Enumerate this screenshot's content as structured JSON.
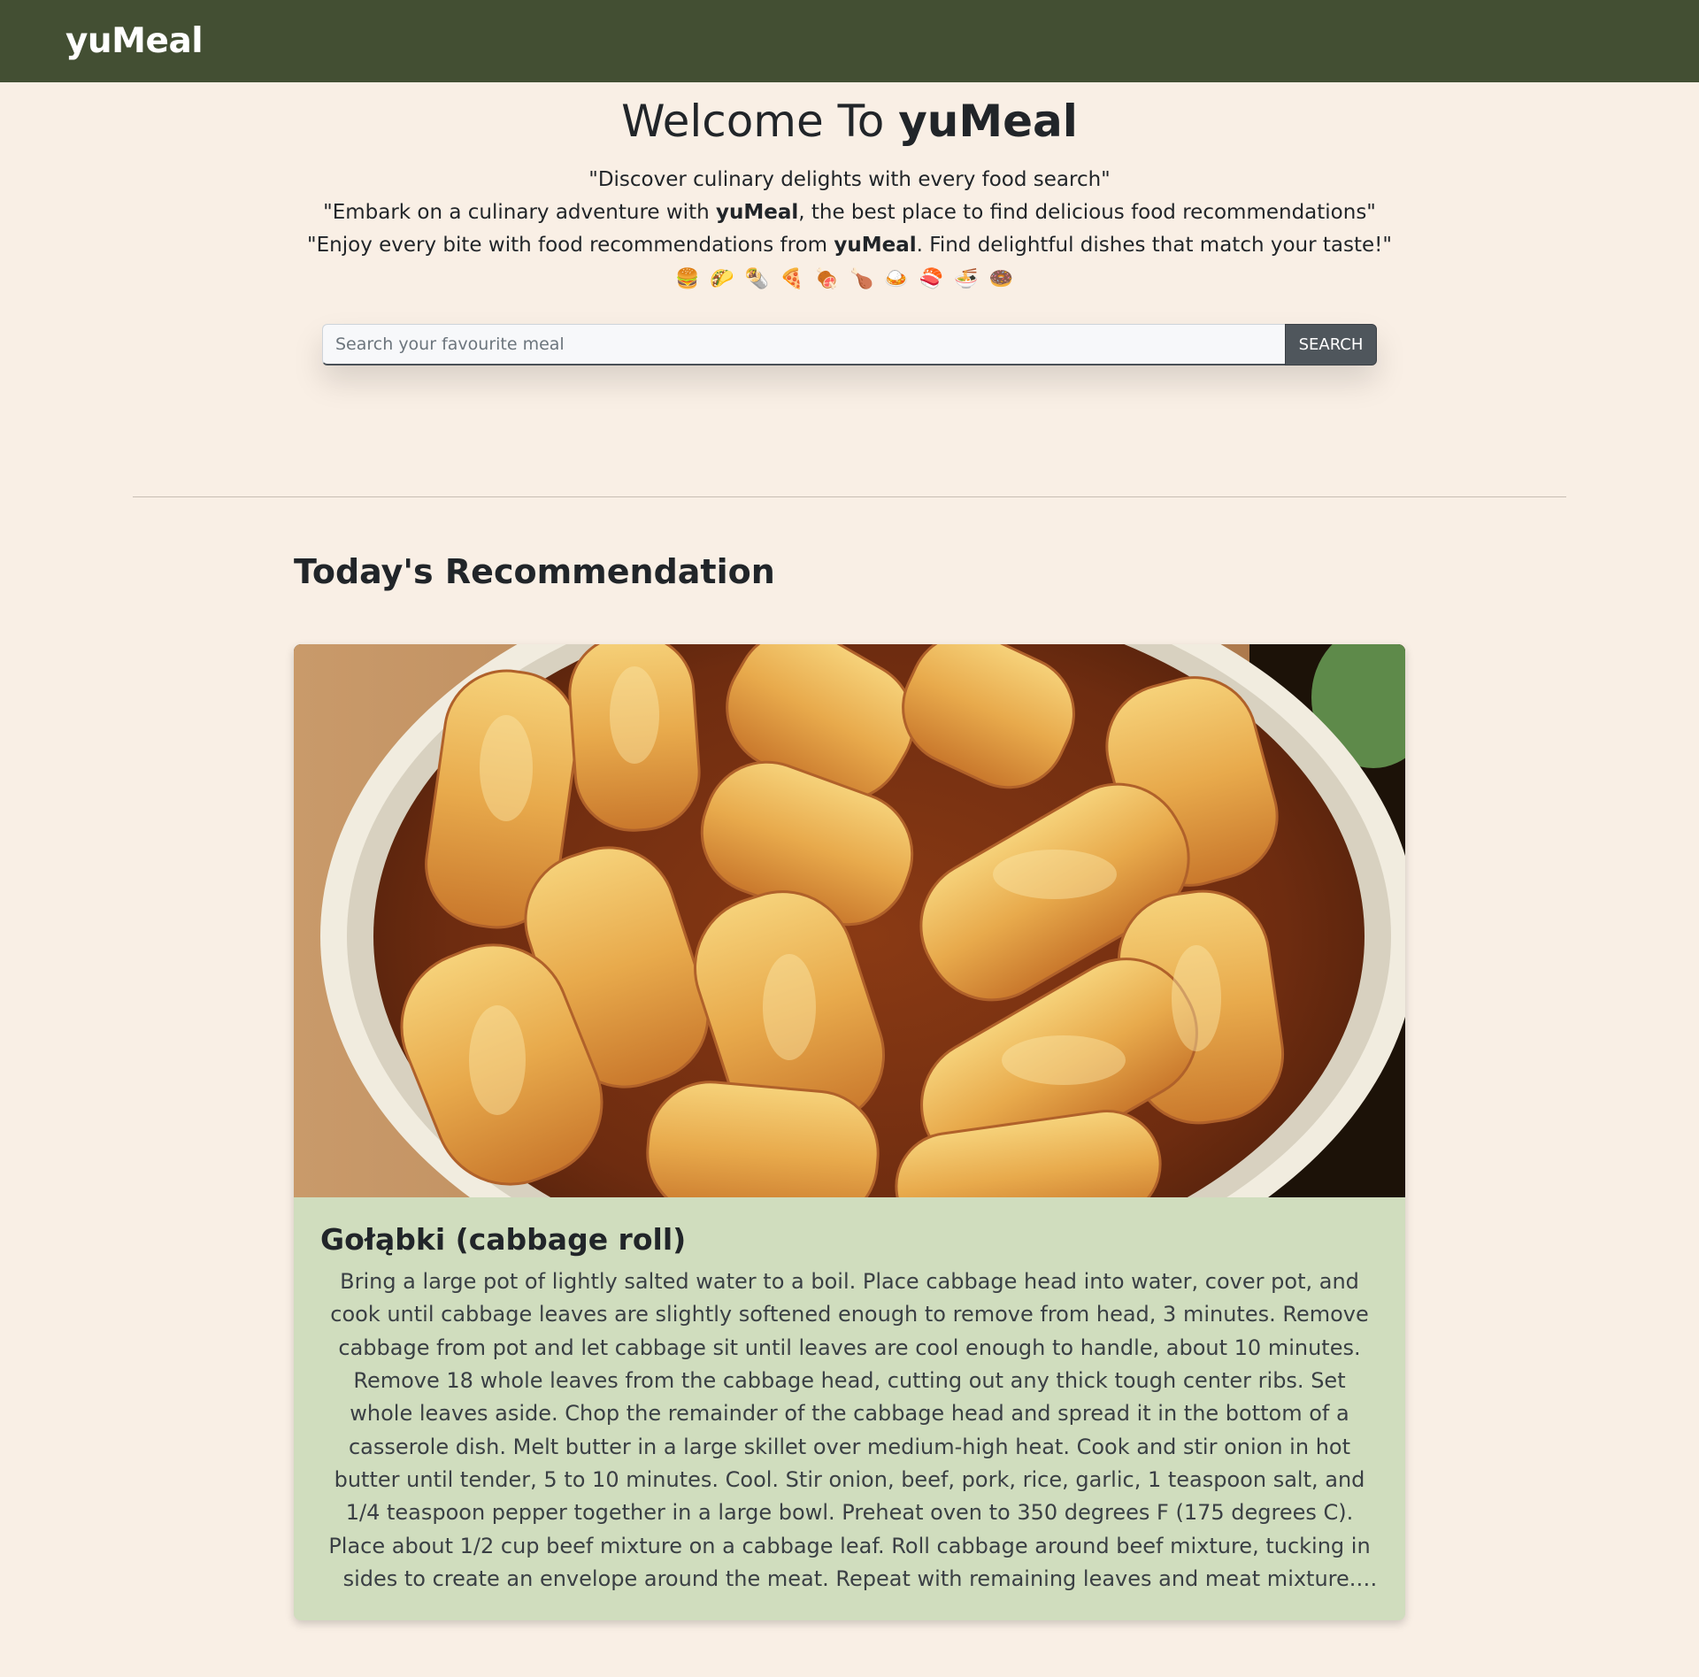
{
  "navbar": {
    "brand": "yuMeal"
  },
  "hero": {
    "title_prefix": "Welcome To ",
    "title_brand": "yuMeal",
    "tagline1": "\"Discover culinary delights with every food search\"",
    "tagline2_pre": "\"Embark on a culinary adventure with ",
    "tagline2_brand": "yuMeal",
    "tagline2_post": ", the best place to find delicious food recommendations\"",
    "tagline3_pre": "\"Enjoy every bite with food recommendations from ",
    "tagline3_brand": "yuMeal",
    "tagline3_post": ". Find delightful dishes that match your taste!\"",
    "emojis": "🍔🌮🌯🍕🍖🍗🍛🍣🍜🍩"
  },
  "search": {
    "placeholder": "Search your favourite meal",
    "value": "",
    "button_label": "SEARCH"
  },
  "recommendation": {
    "heading": "Today's Recommendation",
    "meal_name": "Gołąbki (cabbage roll)",
    "instructions": "Bring a large pot of lightly salted water to a boil. Place cabbage head into water, cover pot, and cook until cabbage leaves are slightly softened enough to remove from head, 3 minutes. Remove cabbage from pot and let cabbage sit until leaves are cool enough to handle, about 10 minutes. Remove 18 whole leaves from the cabbage head, cutting out any thick tough center ribs. Set whole leaves aside. Chop the remainder of the cabbage head and spread it in the bottom of a casserole dish. Melt butter in a large skillet over medium-high heat. Cook and stir onion in hot butter until tender, 5 to 10 minutes. Cool. Stir onion, beef, pork, rice, garlic, 1 teaspoon salt, and 1/4 teaspoon pepper together in a large bowl. Preheat oven to 350 degrees F (175 degrees C). Place about 1/2 cup beef mixture on a cabbage leaf. Roll cabbage around beef mixture, tucking in sides to create an envelope around the meat. Repeat with remaining leaves and meat mixture. Place cabbage rolls in a layer atop the chopped cabbage in the casserole dish; season rolls with salt and pepper..."
  },
  "colors": {
    "navbar_bg": "#434f33",
    "page_bg": "#f9efe5",
    "card_body_bg": "#d0ddbe",
    "search_button_bg": "#4f565c"
  }
}
